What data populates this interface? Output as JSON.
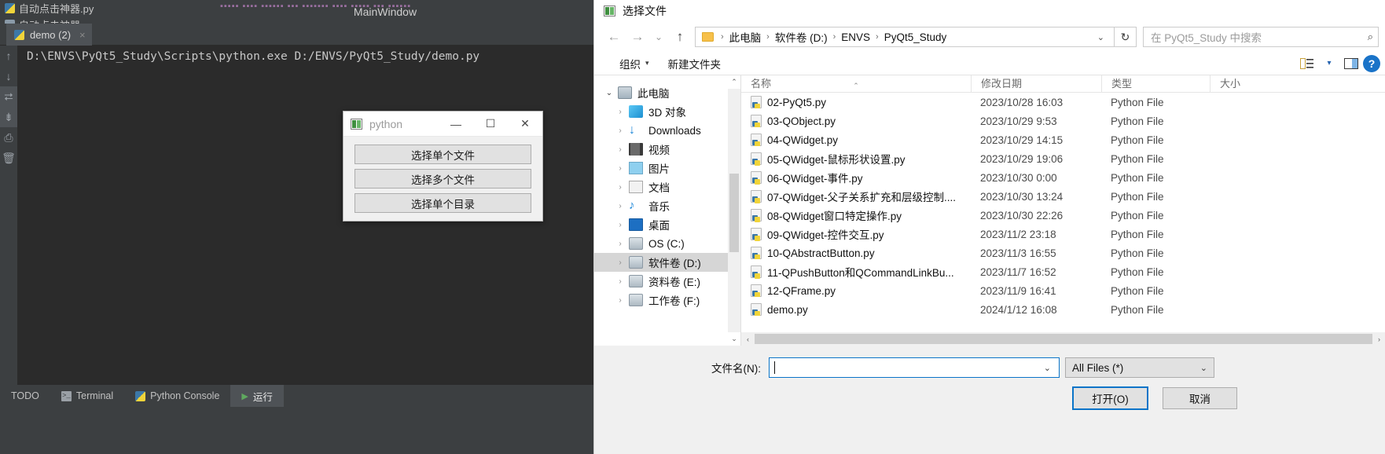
{
  "ide": {
    "project_tabs": [
      {
        "label": "自动点击神器.py",
        "icon": "python-file-icon",
        "selected": false
      },
      {
        "label": "自动点击神器.spec",
        "icon": "spec-file-icon",
        "selected": false
      }
    ],
    "editor_tab_title": "MainWindow",
    "run_tab": {
      "label": "demo (2)",
      "close": "×",
      "icon": "python-run-icon"
    },
    "console_text": "D:\\ENVS\\PyQt5_Study\\Scripts\\python.exe D:/ENVS/PyQt5_Study/demo.py",
    "gutter_icons": [
      "up-arrow-icon",
      "down-arrow-icon",
      "soft-wrap-icon",
      "scroll-to-end-icon",
      "print-icon",
      "trash-icon"
    ],
    "status_items": [
      {
        "label": "TODO",
        "icon": "",
        "active": false
      },
      {
        "label": "Terminal",
        "icon": "terminal-icon",
        "active": false
      },
      {
        "label": "Python Console",
        "icon": "python-console-icon",
        "active": false
      },
      {
        "label": "运行",
        "icon": "run-play-icon",
        "active": true
      }
    ]
  },
  "python_window": {
    "title": "python",
    "minimize": "—",
    "maximize": "☐",
    "close": "✕",
    "buttons": [
      "选择单个文件",
      "选择多个文件",
      "选择单个目录"
    ]
  },
  "file_dialog": {
    "title": "选择文件",
    "nav": {
      "back": "←",
      "forward": "→",
      "recent": "⌄",
      "up": "↑",
      "refresh": "↻",
      "dropdown_caret": "⌄"
    },
    "breadcrumb": [
      "此电脑",
      "软件卷 (D:)",
      "ENVS",
      "PyQt5_Study"
    ],
    "search_placeholder": "在 PyQt5_Study 中搜索",
    "search_icon": "search-icon",
    "toolbar": {
      "organize": "组织",
      "organize_caret": "▾",
      "new_folder": "新建文件夹",
      "view_icon": "view-list-icon",
      "view_caret": "▾",
      "pane_icon": "preview-pane-icon",
      "help_icon": "help-icon",
      "help_glyph": "?"
    },
    "nav_pane": [
      {
        "label": "此电脑",
        "icon": "this-pc-icon",
        "chevron": "⌄",
        "indent": 0,
        "selected": false,
        "expanded": true
      },
      {
        "label": "3D 对象",
        "icon": "3d-objects-icon",
        "chevron": "›",
        "indent": 1,
        "selected": false
      },
      {
        "label": "Downloads",
        "icon": "downloads-icon",
        "chevron": "›",
        "indent": 1,
        "selected": false
      },
      {
        "label": "视频",
        "icon": "videos-icon",
        "chevron": "›",
        "indent": 1,
        "selected": false
      },
      {
        "label": "图片",
        "icon": "pictures-icon",
        "chevron": "›",
        "indent": 1,
        "selected": false
      },
      {
        "label": "文档",
        "icon": "documents-icon",
        "chevron": "›",
        "indent": 1,
        "selected": false
      },
      {
        "label": "音乐",
        "icon": "music-icon",
        "chevron": "›",
        "indent": 1,
        "selected": false
      },
      {
        "label": "桌面",
        "icon": "desktop-icon",
        "chevron": "›",
        "indent": 1,
        "selected": false
      },
      {
        "label": "OS (C:)",
        "icon": "drive-icon",
        "chevron": "›",
        "indent": 1,
        "selected": false
      },
      {
        "label": "软件卷 (D:)",
        "icon": "drive-icon",
        "chevron": "›",
        "indent": 1,
        "selected": true
      },
      {
        "label": "资料卷 (E:)",
        "icon": "drive-icon",
        "chevron": "›",
        "indent": 1,
        "selected": false
      },
      {
        "label": "工作卷 (F:)",
        "icon": "drive-icon",
        "chevron": "›",
        "indent": 1,
        "selected": false
      }
    ],
    "columns": [
      "名称",
      "修改日期",
      "类型",
      "大小"
    ],
    "sort_indicator": "⌃",
    "files": [
      {
        "name": "02-PyQt5.py",
        "date": "2023/10/28 16:03",
        "type": "Python File",
        "size": ""
      },
      {
        "name": "03-QObject.py",
        "date": "2023/10/29 9:53",
        "type": "Python File",
        "size": ""
      },
      {
        "name": "04-QWidget.py",
        "date": "2023/10/29 14:15",
        "type": "Python File",
        "size": ""
      },
      {
        "name": "05-QWidget-鼠标形状设置.py",
        "date": "2023/10/29 19:06",
        "type": "Python File",
        "size": ""
      },
      {
        "name": "06-QWidget-事件.py",
        "date": "2023/10/30 0:00",
        "type": "Python File",
        "size": ""
      },
      {
        "name": "07-QWidget-父子关系扩充和层级控制....",
        "date": "2023/10/30 13:24",
        "type": "Python File",
        "size": ""
      },
      {
        "name": "08-QWidget窗口特定操作.py",
        "date": "2023/10/30 22:26",
        "type": "Python File",
        "size": ""
      },
      {
        "name": "09-QWidget-控件交互.py",
        "date": "2023/11/2 23:18",
        "type": "Python File",
        "size": ""
      },
      {
        "name": "10-QAbstractButton.py",
        "date": "2023/11/3 16:55",
        "type": "Python File",
        "size": ""
      },
      {
        "name": "11-QPushButton和QCommandLinkBu...",
        "date": "2023/11/7 16:52",
        "type": "Python File",
        "size": ""
      },
      {
        "name": "12-QFrame.py",
        "date": "2023/11/9 16:41",
        "type": "Python File",
        "size": ""
      },
      {
        "name": "demo.py",
        "date": "2024/1/12 16:08",
        "type": "Python File",
        "size": ""
      }
    ],
    "footer": {
      "filename_label": "文件名(N):",
      "filename_value": "",
      "filename_caret": "⌄",
      "filter_value": "All Files (*)",
      "filter_caret": "⌄",
      "open_button": "打开(O)",
      "cancel_button": "取消"
    },
    "scroll": {
      "up": "⌃",
      "down": "⌄",
      "left": "‹",
      "right": "›"
    }
  },
  "colors": {
    "ide_bg": "#2b2b2b",
    "ide_panel": "#3c3f41",
    "dialog_bg": "#f0f0f0",
    "accent_blue": "#0a74c8",
    "selection_gray": "#d6d6d6"
  }
}
